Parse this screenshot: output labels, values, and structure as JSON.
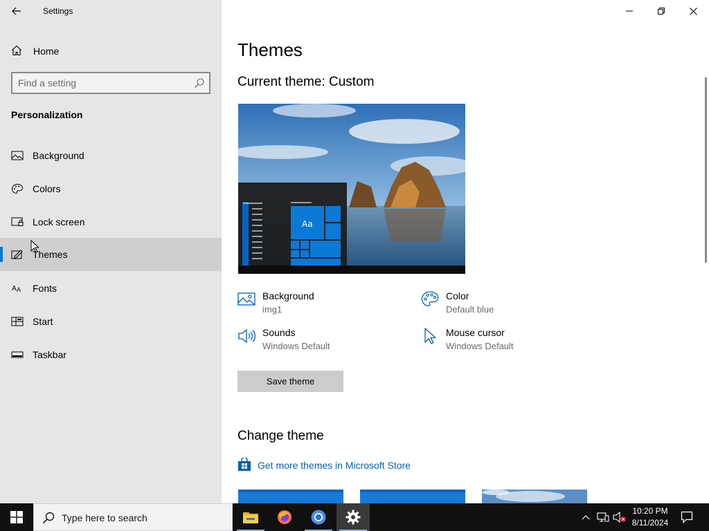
{
  "window": {
    "title": "Settings",
    "controls": [
      "minimize",
      "restore",
      "close"
    ]
  },
  "sidebar": {
    "home_label": "Home",
    "search": {
      "placeholder": "Find a setting",
      "value": ""
    },
    "section_title": "Personalization",
    "items": [
      {
        "label": "Background",
        "icon": "picture-icon",
        "selected": false
      },
      {
        "label": "Colors",
        "icon": "palette-icon",
        "selected": false
      },
      {
        "label": "Lock screen",
        "icon": "lock-screen-icon",
        "selected": false
      },
      {
        "label": "Themes",
        "icon": "brush-icon",
        "selected": true
      },
      {
        "label": "Fonts",
        "icon": "font-icon",
        "selected": false
      },
      {
        "label": "Start",
        "icon": "start-icon",
        "selected": false
      },
      {
        "label": "Taskbar",
        "icon": "taskbar-icon",
        "selected": false
      }
    ]
  },
  "main": {
    "title": "Themes",
    "current_theme": "Current theme: Custom",
    "preview_tile_label": "Aa",
    "properties": [
      {
        "name": "Background",
        "value": "img1",
        "icon": "picture-icon"
      },
      {
        "name": "Color",
        "value": "Default blue",
        "icon": "palette-icon"
      },
      {
        "name": "Sounds",
        "value": "Windows Default",
        "icon": "speaker-icon"
      },
      {
        "name": "Mouse cursor",
        "value": "Windows Default",
        "icon": "cursor-icon"
      }
    ],
    "save_button": "Save theme",
    "change_theme_heading": "Change theme",
    "store_link": "Get more themes in Microsoft Store"
  },
  "taskbar": {
    "search_placeholder": "Type here to search",
    "apps": [
      "file-explorer",
      "firefox",
      "chromium",
      "settings"
    ],
    "active_app": "settings",
    "time": "10:20 PM",
    "date": "8/11/2024"
  },
  "colors": {
    "accent": "#0078d7",
    "sidebar_bg": "#e6e6e6",
    "selected_bg": "#cfcfcf",
    "link": "#005fb8",
    "taskbar_bg": "#101010"
  }
}
